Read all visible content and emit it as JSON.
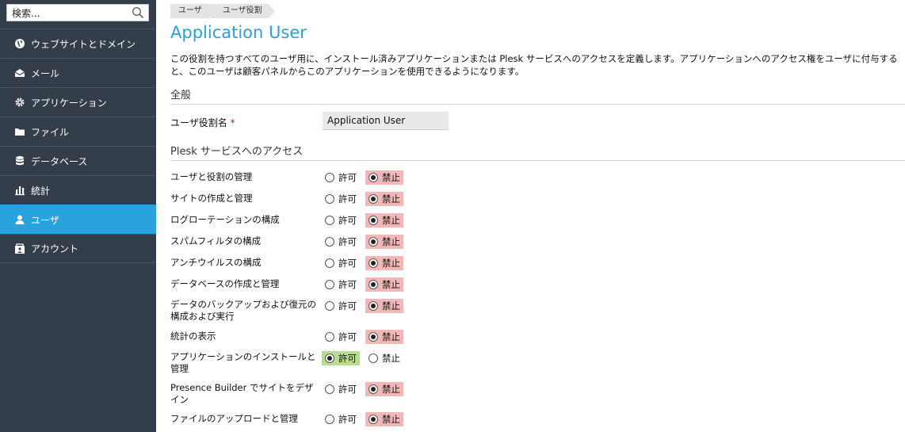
{
  "search": {
    "placeholder": "検索..."
  },
  "sidebar": {
    "items": [
      {
        "label": "ウェブサイトとドメイン",
        "icon": "globe-icon"
      },
      {
        "label": "メール",
        "icon": "mail-icon"
      },
      {
        "label": "アプリケーション",
        "icon": "gear-icon"
      },
      {
        "label": "ファイル",
        "icon": "folder-icon"
      },
      {
        "label": "データベース",
        "icon": "database-icon"
      },
      {
        "label": "統計",
        "icon": "chart-icon"
      },
      {
        "label": "ユーザ",
        "icon": "user-icon",
        "active": true
      },
      {
        "label": "アカウント",
        "icon": "account-icon"
      }
    ]
  },
  "breadcrumb": [
    "ユーザ",
    "ユーザ役割"
  ],
  "page": {
    "title": "Application User",
    "description": "この役割を持つすべてのユーザ用に、インストール済みアプリケーションまたは Plesk サービスへのアクセスを定義します。アプリケーションへのアクセス権をユーザに付与すると、このユーザは顧客パネルからこのアプリケーションを使用できるようになります。"
  },
  "general": {
    "heading": "全般",
    "role_name_label": "ユーザ役割名",
    "required_mark": "*",
    "role_name_value": "Application User"
  },
  "access": {
    "heading": "Plesk サービスへのアクセス",
    "allow_label": "許可",
    "deny_label": "禁止",
    "permissions": [
      {
        "label": "ユーザと役割の管理",
        "value": "deny"
      },
      {
        "label": "サイトの作成と管理",
        "value": "deny"
      },
      {
        "label": "ログローテーションの構成",
        "value": "deny"
      },
      {
        "label": "スパムフィルタの構成",
        "value": "deny"
      },
      {
        "label": "アンチウイルスの構成",
        "value": "deny"
      },
      {
        "label": "データベースの作成と管理",
        "value": "deny"
      },
      {
        "label": "データのバックアップおよび復元の構成および実行",
        "value": "deny"
      },
      {
        "label": "統計の表示",
        "value": "deny"
      },
      {
        "label": "アプリケーションのインストールと管理",
        "value": "allow"
      },
      {
        "label": "Presence Builder でサイトをデザイン",
        "value": "deny"
      },
      {
        "label": "ファイルのアップロードと管理",
        "value": "deny"
      }
    ]
  },
  "colors": {
    "sidebar_bg": "#343e4a",
    "active_bg": "#29a3dd",
    "title": "#2a9fd8",
    "deny_highlight": "#f2b8b8",
    "allow_highlight": "#b8dc90"
  }
}
